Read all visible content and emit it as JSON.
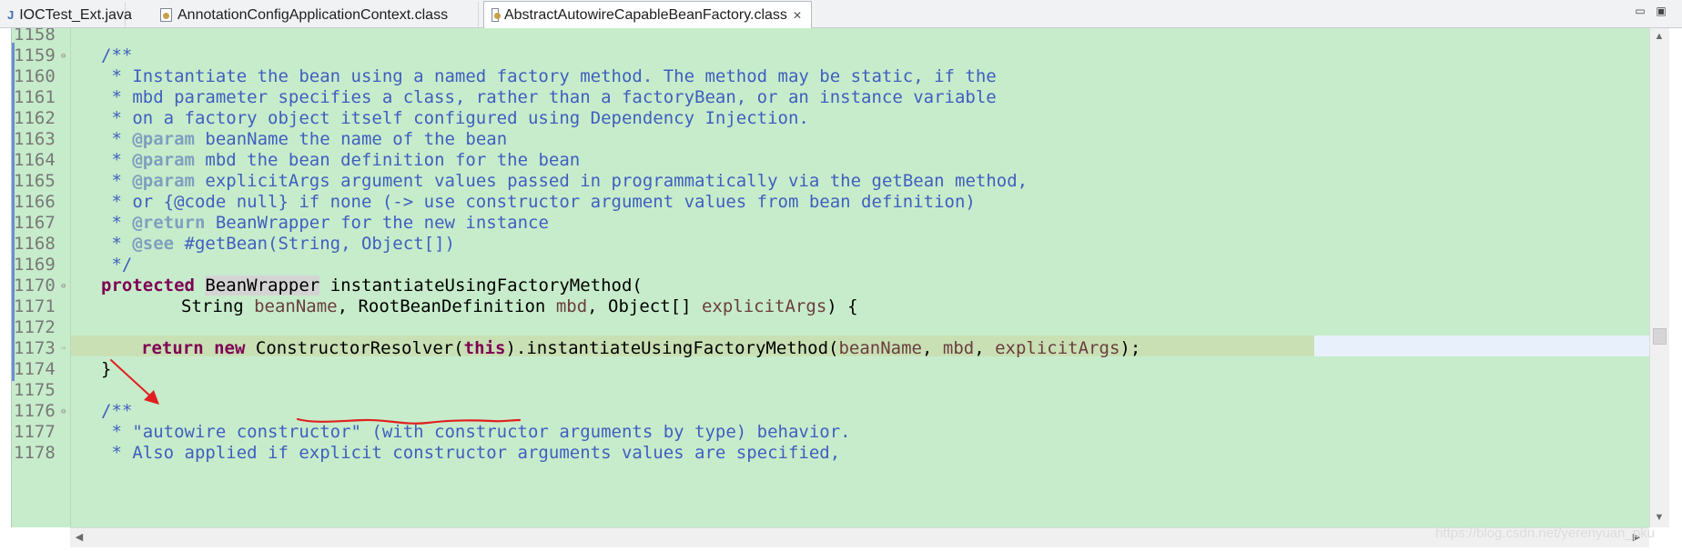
{
  "tabs": [
    {
      "label": "IOCTest_Ext.java",
      "icon": "java-file-icon"
    },
    {
      "label": "AnnotationConfigApplicationContext.class",
      "icon": "class-file-icon"
    },
    {
      "label": "AbstractAutowireCapableBeanFactory.class",
      "icon": "class-file-icon",
      "active": true,
      "close": "✕"
    }
  ],
  "window_controls": {
    "minimize": "▭",
    "maximize": "▣"
  },
  "line_numbers": [
    "1158",
    "1159",
    "1160",
    "1161",
    "1162",
    "1163",
    "1164",
    "1165",
    "1166",
    "1167",
    "1168",
    "1169",
    "1170",
    "1171",
    "1172",
    "1173",
    "1174",
    "1175",
    "1176",
    "1177",
    "1178"
  ],
  "code": {
    "l1159": "/**",
    "l1160": " * Instantiate the bean using a named factory method. The method may be static, if the",
    "l1161": " * mbd parameter specifies a class, rather than a factoryBean, or an instance variable",
    "l1162": " * on a factory object itself configured using Dependency Injection.",
    "l1163_tag": "@param",
    "l1163_text": " beanName the name of the bean",
    "l1164_tag": "@param",
    "l1164_text": " mbd the bean definition for the bean",
    "l1165_tag": "@param",
    "l1165_text": " explicitArgs argument values passed in programmatically via the getBean method,",
    "l1166": " * or {@code null} if none (-> use constructor argument values from bean definition)",
    "l1167_tag": "@return",
    "l1167_text": " BeanWrapper for the new instance",
    "l1168_tag": "@see",
    "l1168_text": " #getBean(String, Object[])",
    "l1169": " */",
    "l1170_kw": "protected",
    "l1170_type": "BeanWrapper",
    "l1170_rest": " instantiateUsingFactoryMethod(",
    "l1171_a": "String ",
    "l1171_v1": "beanName",
    "l1171_b": ", RootBeanDefinition ",
    "l1171_v2": "mbd",
    "l1171_c": ", Object[] ",
    "l1171_v3": "explicitArgs",
    "l1171_d": ") {",
    "l1173_kw1": "return",
    "l1173_kw2": "new",
    "l1173_cls": "ConstructorResolver",
    "l1173_this": "this",
    "l1173_call": ").instantiateUsingFactoryMethod(",
    "l1173_v1": "beanName",
    "l1173_v2": "mbd",
    "l1173_v3": "explicitArgs",
    "l1173_end": ");",
    "l1174": "}",
    "l1176": "/**",
    "l1177": " * \"autowire constructor\" (with constructor arguments by type) behavior.",
    "l1178": " * Also applied if explicit constructor arguments values are specified,"
  },
  "watermark": "https://blog.csdn.net/yerenyuan_pku",
  "colors": {
    "editor_bg": "#c7eccb",
    "javadoc": "#3f5fbf",
    "javadoc_tag": "#7f9fbf",
    "keyword": "#7f0055",
    "variable": "#6a3e3e",
    "current_line": "#e8f1fb",
    "annotation_red": "#e02020"
  }
}
